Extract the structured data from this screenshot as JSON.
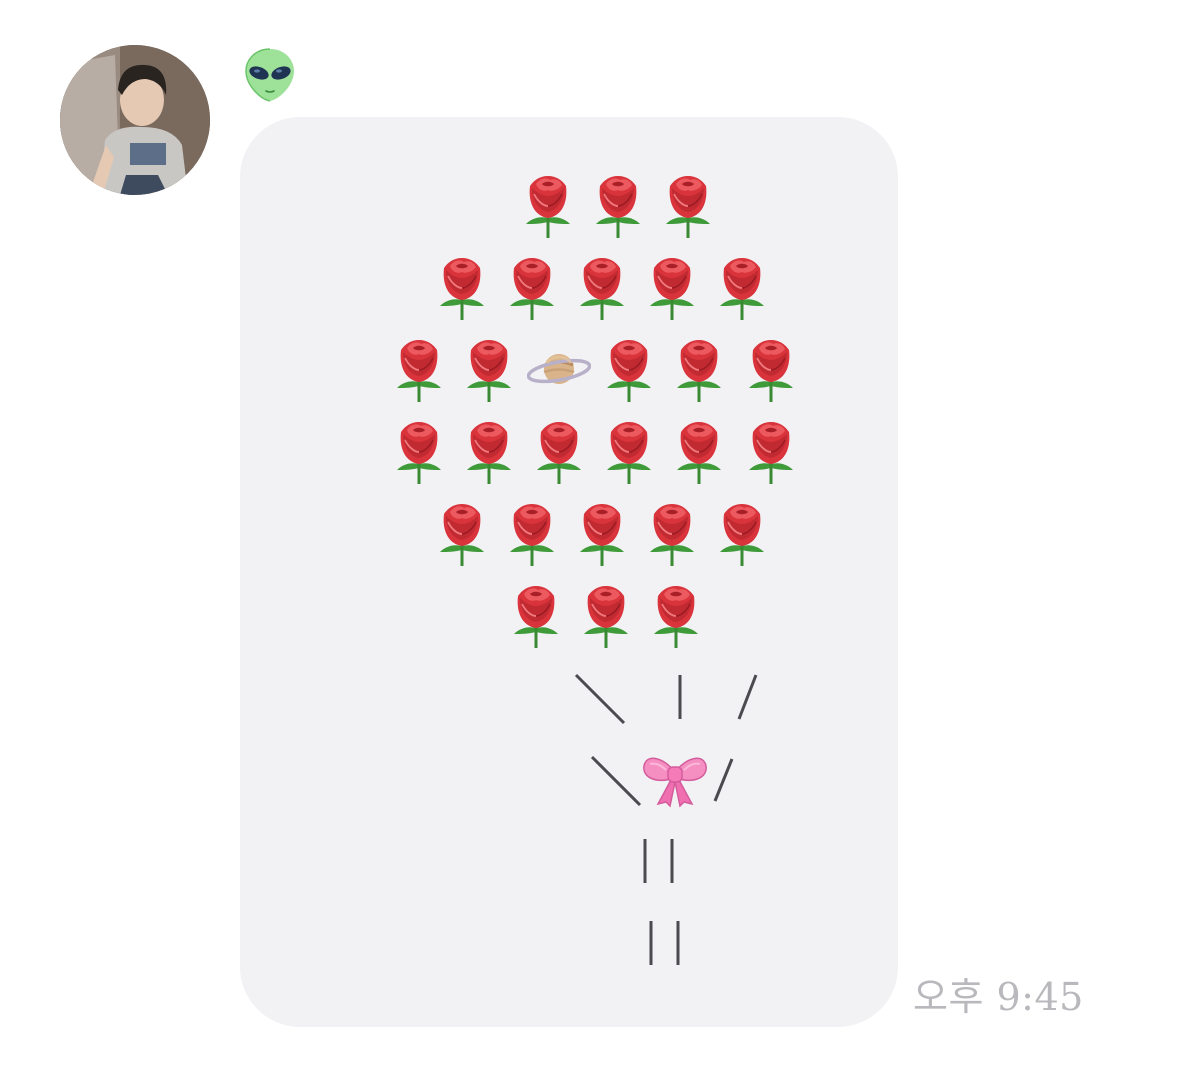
{
  "chat": {
    "sender": {
      "avatar": "profile-photo",
      "badge_emoji": "👽"
    },
    "message": {
      "type": "emoji-art",
      "art_rows": [
        "🌹🌹🌹",
        "🌹🌹🌹🌹🌹",
        "🌹🌹🪐🌹🌹🌹",
        "🌹🌹🌹🌹🌹🌹",
        "🌹🌹🌹🌹🌹",
        "🌹🌹🌹",
        "＼ | /",
        "＼🎀/",
        "||",
        "||"
      ],
      "bubble_color": "#f2f2f5"
    },
    "timestamp": "오후 9:45",
    "timestamp_color": "#b8b8bd"
  },
  "icons": {
    "rose": "rose-icon",
    "planet": "ringed-planet-icon",
    "bow": "ribbon-bow-icon",
    "alien": "alien-icon"
  }
}
